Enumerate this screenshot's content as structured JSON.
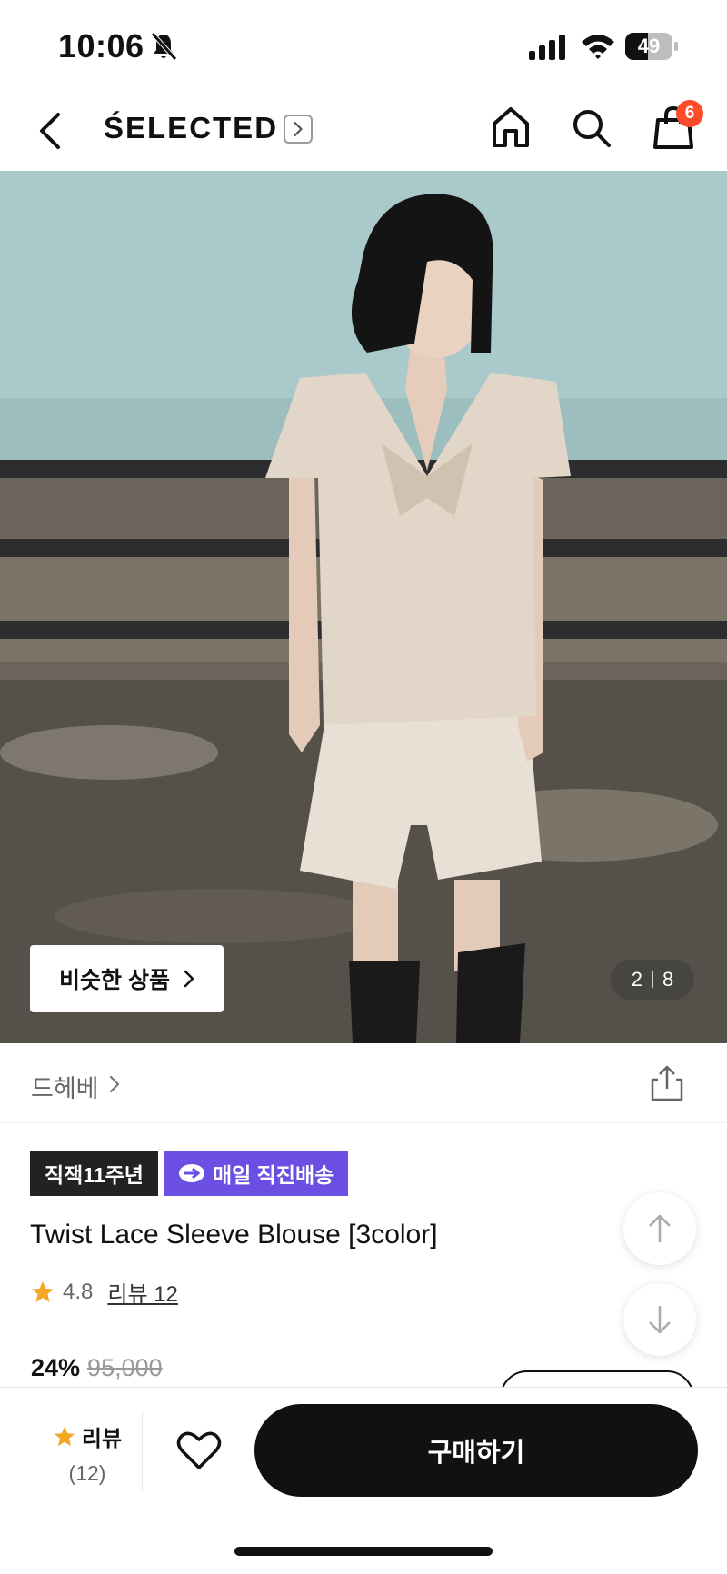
{
  "status_bar": {
    "time": "10:06",
    "battery": "49",
    "battery_level": 0.49
  },
  "nav": {
    "brand": "ŚELECTED",
    "cart_count": "6"
  },
  "hero": {
    "similar_label": "비슷한 상품",
    "page_current": "2",
    "page_total": "8"
  },
  "store": {
    "name": "드헤베"
  },
  "tags": {
    "anniversary": "직잭11주년",
    "delivery": "매일 직진배송"
  },
  "product": {
    "title": "Twist Lace Sleeve Blouse [3color]",
    "rating": "4.8",
    "review_link": "리뷰 12",
    "discount": "24%",
    "original_price": "95,000"
  },
  "bottom_bar": {
    "review_label": "리뷰",
    "review_count": "(12)",
    "buy_label": "구매하기"
  },
  "colors": {
    "accent_purple": "#6a4fe2",
    "badge_red": "#ff4b2b",
    "star": "#f5a623"
  }
}
